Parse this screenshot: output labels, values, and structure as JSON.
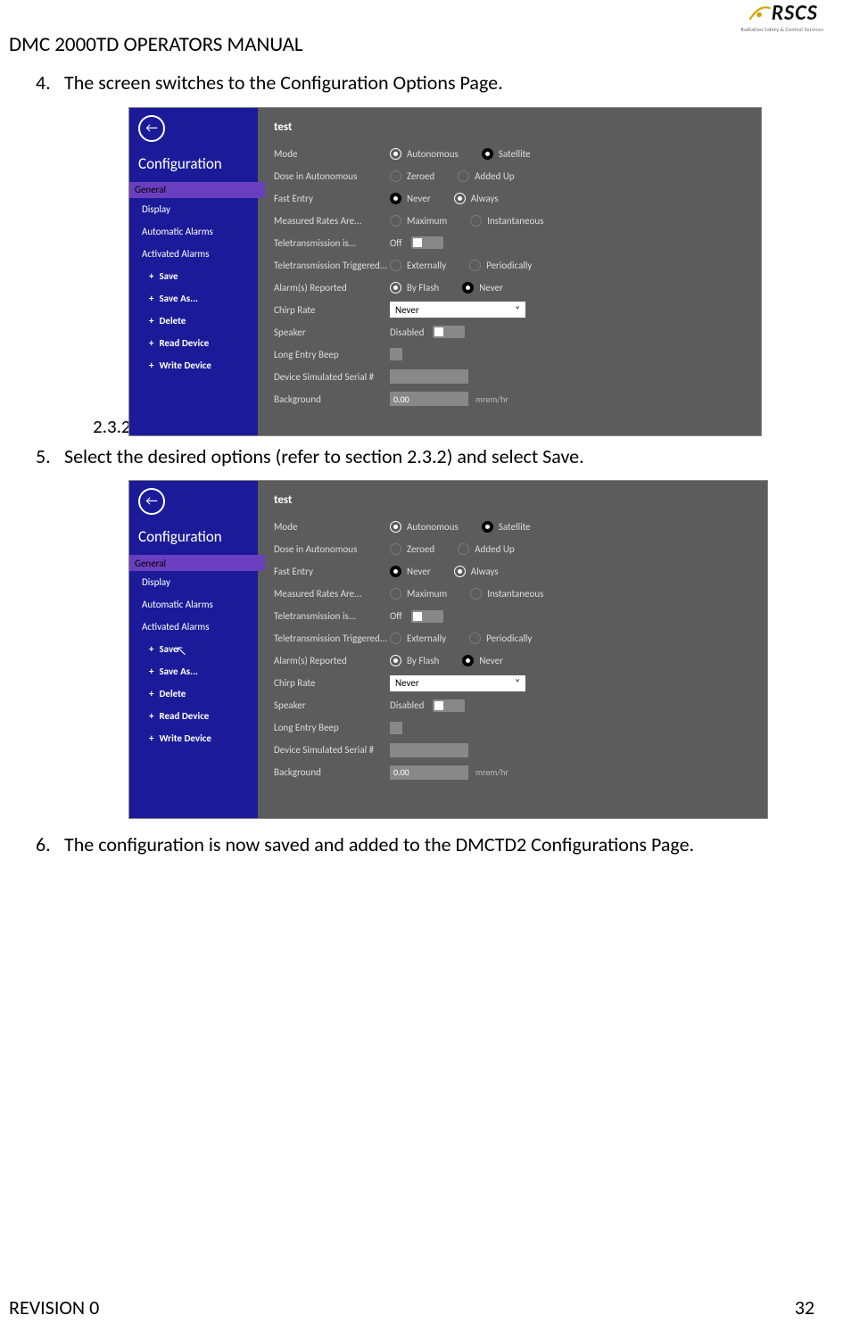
{
  "header": {
    "title": "DMC 2000TD OPERATORS MANUAL"
  },
  "logo": {
    "name": "RSCS",
    "sub": "Radiation Safety & Control Services"
  },
  "footer": {
    "rev": "REVISION 0",
    "page": "32"
  },
  "steps": {
    "s4": {
      "n": "4.",
      "t": "The screen switches to the Configuration Options Page."
    },
    "s5": {
      "n": "5.",
      "t": "Select the desired options (refer to section 2.3.2) and select Save."
    },
    "s6": {
      "n": "6.",
      "t": "The configuration is now saved and added to the DMCTD2 Configurations Page."
    },
    "ref": "2.3.2"
  },
  "ui": {
    "back": "←",
    "cfg": "Configuration",
    "menu": {
      "general": "General",
      "display": "Display",
      "autoAlarms": "Automatic Alarms",
      "actAlarms": "Activated Alarms",
      "save": "Save",
      "saveAs": "Save As...",
      "delete": "Delete",
      "readDev": "Read Device",
      "writeDev": "Write Device",
      "plus": "+"
    },
    "panel": {
      "title": "test",
      "rows": {
        "mode": {
          "l": "Mode",
          "a": "Autonomous",
          "b": "Satellite"
        },
        "dose": {
          "l": "Dose in Autonomous",
          "a": "Zeroed",
          "b": "Added Up"
        },
        "fast": {
          "l": "Fast Entry",
          "a": "Never",
          "b": "Always"
        },
        "rates": {
          "l": "Measured Rates Are...",
          "a": "Maximum",
          "b": "Instantaneous"
        },
        "tele": {
          "l": "Teletransmission is...",
          "state": "Off"
        },
        "teleTrig": {
          "l": "Teletransmission Triggered...",
          "a": "Externally",
          "b": "Periodically"
        },
        "alarm": {
          "l": "Alarm(s) Reported",
          "a": "By Flash",
          "b": "Never"
        },
        "chirp": {
          "l": "Chirp Rate",
          "val": "Never",
          "chev": "˅"
        },
        "speaker": {
          "l": "Speaker",
          "state": "Disabled"
        },
        "beep": {
          "l": "Long Entry Beep"
        },
        "serial": {
          "l": "Device Simulated Serial #"
        },
        "bg": {
          "l": "Background",
          "val": "0.00",
          "unit": "mrem/hr"
        }
      }
    }
  }
}
